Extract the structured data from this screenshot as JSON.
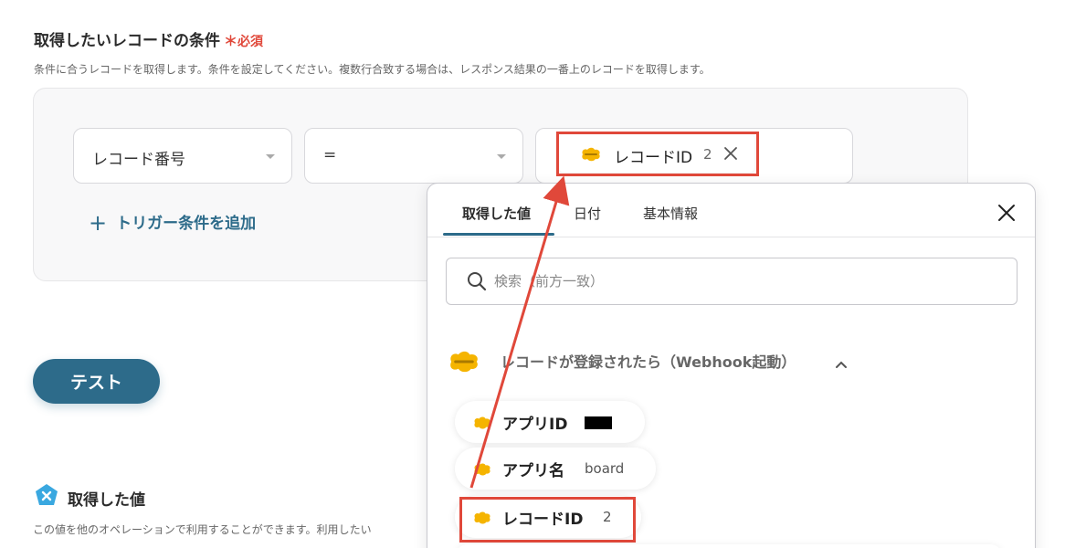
{
  "section": {
    "title": "取得したいレコードの条件",
    "required_mark": "＊",
    "required_label": "必須",
    "description": "条件に合うレコードを取得します。条件を設定してください。複数行合致する場合は、レスポンス結果の一番上のレコードを取得します。"
  },
  "condition": {
    "field_select": "レコード番号",
    "operator_select": "=",
    "value_chip": {
      "label": "レコードID",
      "value": "2"
    },
    "add_trigger_label": "トリガー条件を追加"
  },
  "test_button": "テスト",
  "obtained": {
    "title": "取得した値",
    "description": "この値を他のオペレーションで利用することができます。利用したい"
  },
  "popup": {
    "tabs": [
      "取得した値",
      "日付",
      "基本情報"
    ],
    "search_placeholder": "検索（前方一致）",
    "group_label": "レコードが登録されたら（Webhook起動）",
    "items": [
      {
        "label": "アプリID",
        "value": ""
      },
      {
        "label": "アプリ名",
        "value": "board"
      },
      {
        "label": "レコードID",
        "value": "2"
      }
    ]
  },
  "colors": {
    "accent": "#2d6b8a",
    "highlight": "#e0483a",
    "kintone_logo": "#f5b400"
  }
}
